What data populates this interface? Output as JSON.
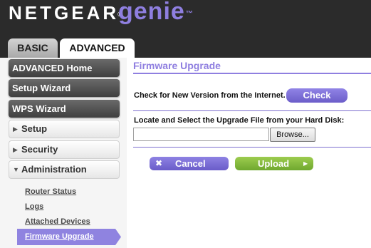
{
  "header": {
    "brand": "NETGEAR",
    "brand_mark": "®",
    "product": "genie",
    "product_mark": "™"
  },
  "tabs": [
    {
      "label": "BASIC",
      "active": false
    },
    {
      "label": "ADVANCED",
      "active": true
    }
  ],
  "sidebar": {
    "primary": [
      {
        "label": "ADVANCED Home"
      },
      {
        "label": "Setup Wizard"
      },
      {
        "label": "WPS Wizard"
      }
    ],
    "sections": [
      {
        "label": "Setup",
        "icon": "triangle-right-icon",
        "expanded": false
      },
      {
        "label": "Security",
        "icon": "triangle-right-icon",
        "expanded": false
      },
      {
        "label": "Administration",
        "icon": "triangle-down-icon",
        "expanded": true
      }
    ],
    "sub_items": [
      {
        "label": "Router Status"
      },
      {
        "label": "Logs"
      },
      {
        "label": "Attached Devices"
      },
      {
        "label": "Firmware Upgrade",
        "active": true
      }
    ]
  },
  "main": {
    "title": "Firmware Upgrade",
    "check_label": "Check for New Version from the Internet.",
    "check_button": "Check",
    "locate_label": "Locate and Select the Upgrade File from your Hard Disk:",
    "file_value": "",
    "browse_button": "Browse...",
    "cancel_button": "Cancel",
    "cancel_icon": "✖",
    "upload_button": "Upload",
    "upload_icon": "▶"
  },
  "colors": {
    "accent": "#8f7fe0",
    "header_bg": "#2b2b2b",
    "upload_green": "#7fb83a"
  }
}
